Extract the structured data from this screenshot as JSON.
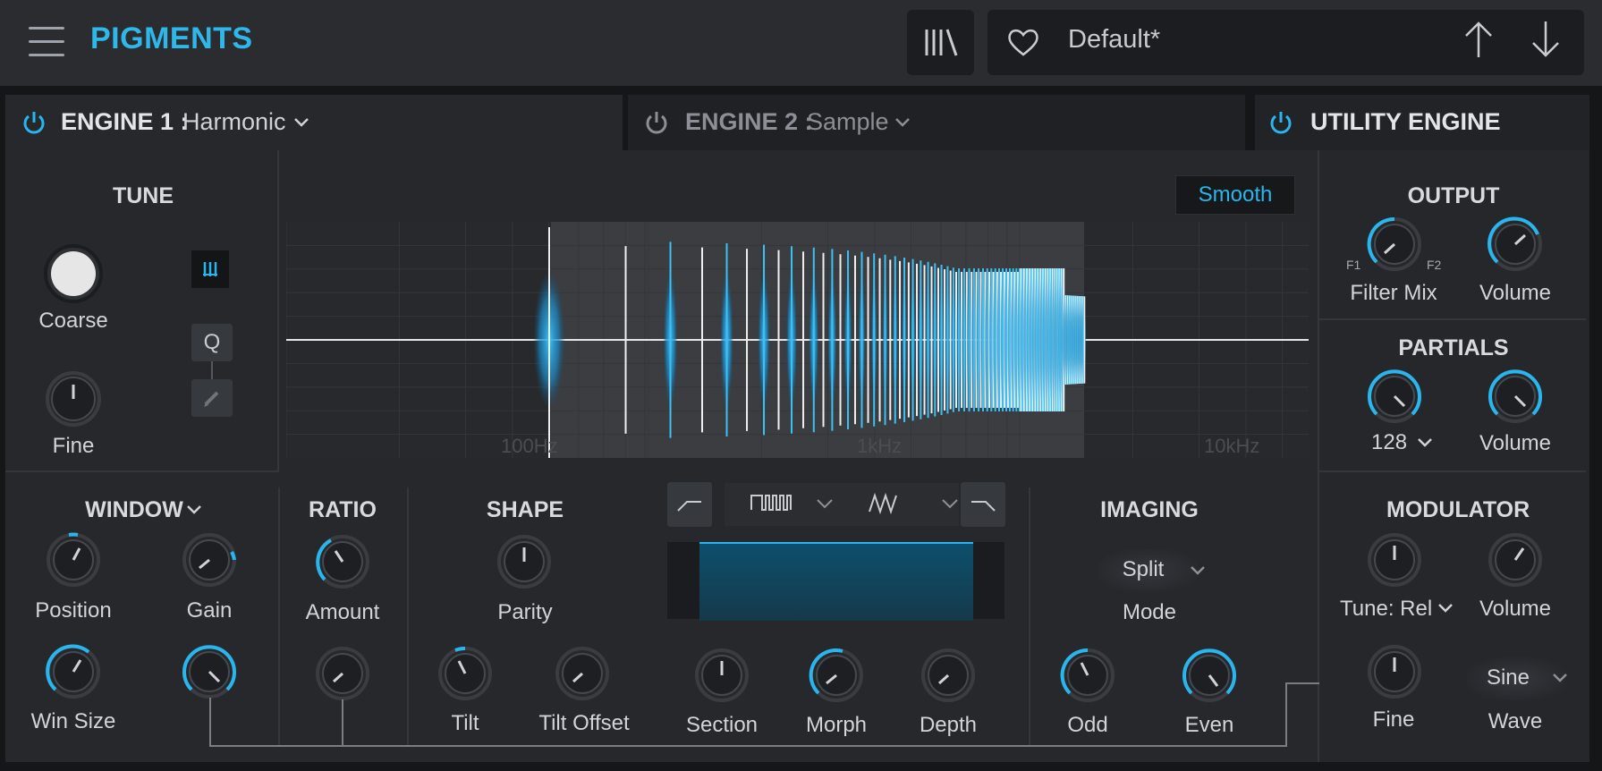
{
  "app": {
    "logo": "PIGMENTS"
  },
  "preset": {
    "name": "Default*"
  },
  "tabs": {
    "engine1": {
      "label": "ENGINE 1 :",
      "value": "Harmonic"
    },
    "engine2": {
      "label": "ENGINE 2 :",
      "value": "Sample"
    },
    "utility": {
      "label": "UTILITY ENGINE"
    }
  },
  "tune": {
    "title": "TUNE",
    "coarse": "Coarse",
    "fine": "Fine",
    "q_button": "Q"
  },
  "spectrum": {
    "smooth_label": "Smooth",
    "axis": [
      "100Hz",
      "1kHz",
      "10kHz"
    ]
  },
  "output": {
    "title": "OUTPUT",
    "filter_mix": "Filter Mix",
    "volume": "Volume",
    "f1": "F1",
    "f2": "F2"
  },
  "partials": {
    "title": "PARTIALS",
    "count": "128",
    "volume": "Volume"
  },
  "window": {
    "title": "WINDOW",
    "position": "Position",
    "gain": "Gain",
    "win_size": "Win Size"
  },
  "ratio": {
    "title": "RATIO",
    "amount": "Amount"
  },
  "shape": {
    "title": "SHAPE",
    "parity": "Parity",
    "tilt": "Tilt",
    "tilt_offset": "Tilt Offset",
    "section": "Section",
    "morph": "Morph",
    "depth": "Depth"
  },
  "imaging": {
    "title": "IMAGING",
    "mode_value": "Split",
    "mode": "Mode",
    "odd": "Odd",
    "even": "Even"
  },
  "modulator": {
    "title": "MODULATOR",
    "tune_mode": "Tune: Rel",
    "volume": "Volume",
    "fine": "Fine",
    "wave_value": "Sine",
    "wave": "Wave"
  },
  "colors": {
    "accent": "#29b6ef",
    "background": "#26282c",
    "topbar": "#2a2c30"
  }
}
